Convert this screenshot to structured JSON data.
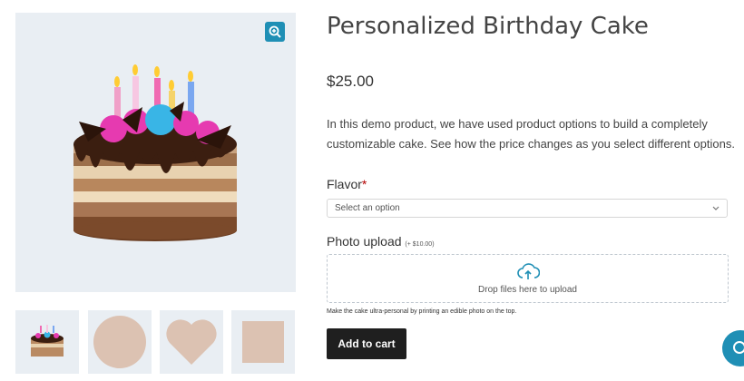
{
  "product": {
    "title": "Personalized Birthday Cake",
    "price": "$25.00",
    "description": "In this demo product, we have used product options to build a completely customizable cake. See how the price changes as you select different options."
  },
  "options": {
    "flavor": {
      "label": "Flavor",
      "required_mark": "*",
      "placeholder": "Select an option"
    },
    "photo": {
      "label": "Photo upload",
      "price_note": "(+ $10.00)",
      "dropzone_text": "Drop files here to upload",
      "help_text": "Make the cake ultra-personal by printing an edible photo on the top."
    }
  },
  "actions": {
    "add_to_cart": "Add to cart"
  },
  "gallery": {
    "thumbnails": [
      "cake",
      "circle",
      "heart",
      "square"
    ]
  },
  "icons": {
    "zoom": "zoom-in-icon",
    "upload": "cloud-upload-icon",
    "chevron": "chevron-down-icon",
    "chat": "chat-icon"
  },
  "colors": {
    "accent": "#1f8fb5",
    "button": "#1f1f1f",
    "required": "#b30000",
    "shape": "#dcc2b2"
  }
}
